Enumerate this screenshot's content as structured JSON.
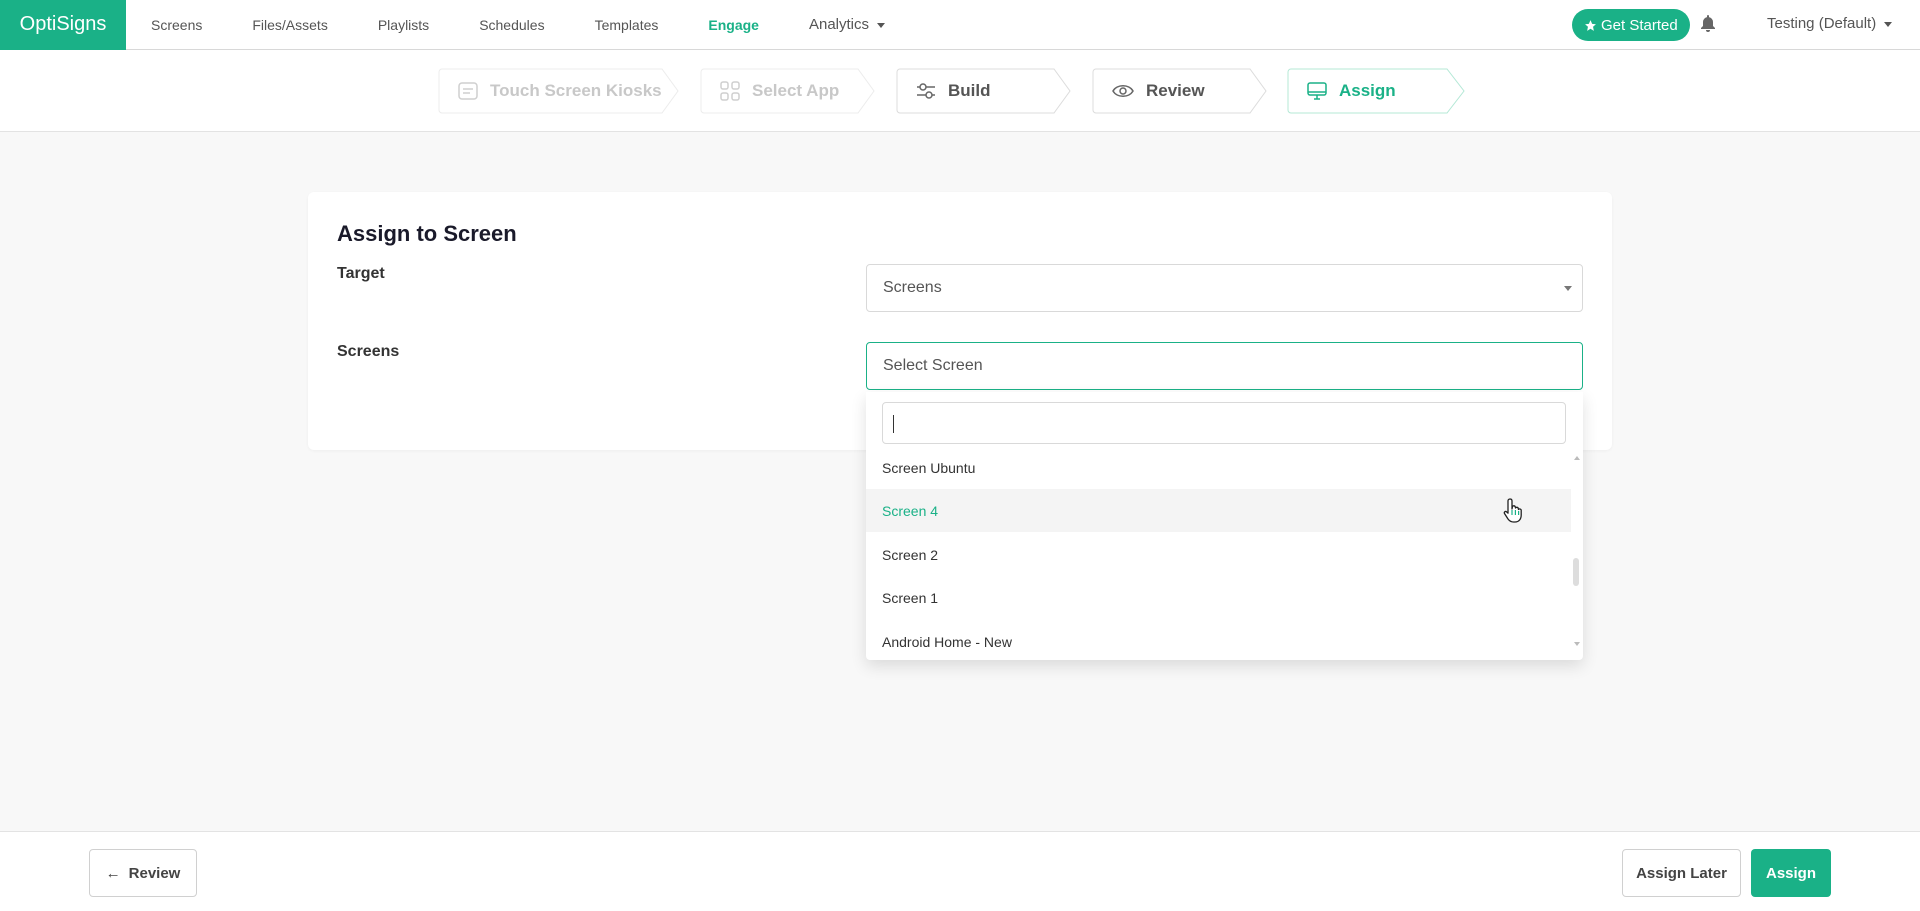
{
  "brand": {
    "name": "OptiSigns",
    "accent": "#1ab187"
  },
  "nav": {
    "items": [
      {
        "label": "Screens"
      },
      {
        "label": "Files/Assets"
      },
      {
        "label": "Playlists"
      },
      {
        "label": "Schedules"
      },
      {
        "label": "Templates"
      },
      {
        "label": "Engage",
        "active": true
      },
      {
        "label": "Analytics",
        "dropdown": true
      }
    ],
    "get_started": "Get Started",
    "account": "Testing (Default)"
  },
  "steps": [
    {
      "label": "Touch Screen Kiosks",
      "state": "done",
      "icon": "list-icon"
    },
    {
      "label": "Select App",
      "state": "done",
      "icon": "grid-icon"
    },
    {
      "label": "Build",
      "state": "normal",
      "icon": "sliders-icon"
    },
    {
      "label": "Review",
      "state": "normal",
      "icon": "eye-icon"
    },
    {
      "label": "Assign",
      "state": "current",
      "icon": "monitor-icon"
    }
  ],
  "card": {
    "title": "Assign to Screen",
    "target_label": "Target",
    "target_value": "Screens",
    "screens_label": "Screens",
    "screens_placeholder": "Select Screen"
  },
  "dropdown": {
    "search_value": "",
    "options": [
      {
        "label": "Screen Ubuntu"
      },
      {
        "label": "Screen 4",
        "hovered": true
      },
      {
        "label": "Screen 2"
      },
      {
        "label": "Screen 1"
      },
      {
        "label": "Android Home - New"
      }
    ]
  },
  "footer": {
    "back_label": "Review",
    "assign_later_label": "Assign Later",
    "assign_label": "Assign"
  }
}
